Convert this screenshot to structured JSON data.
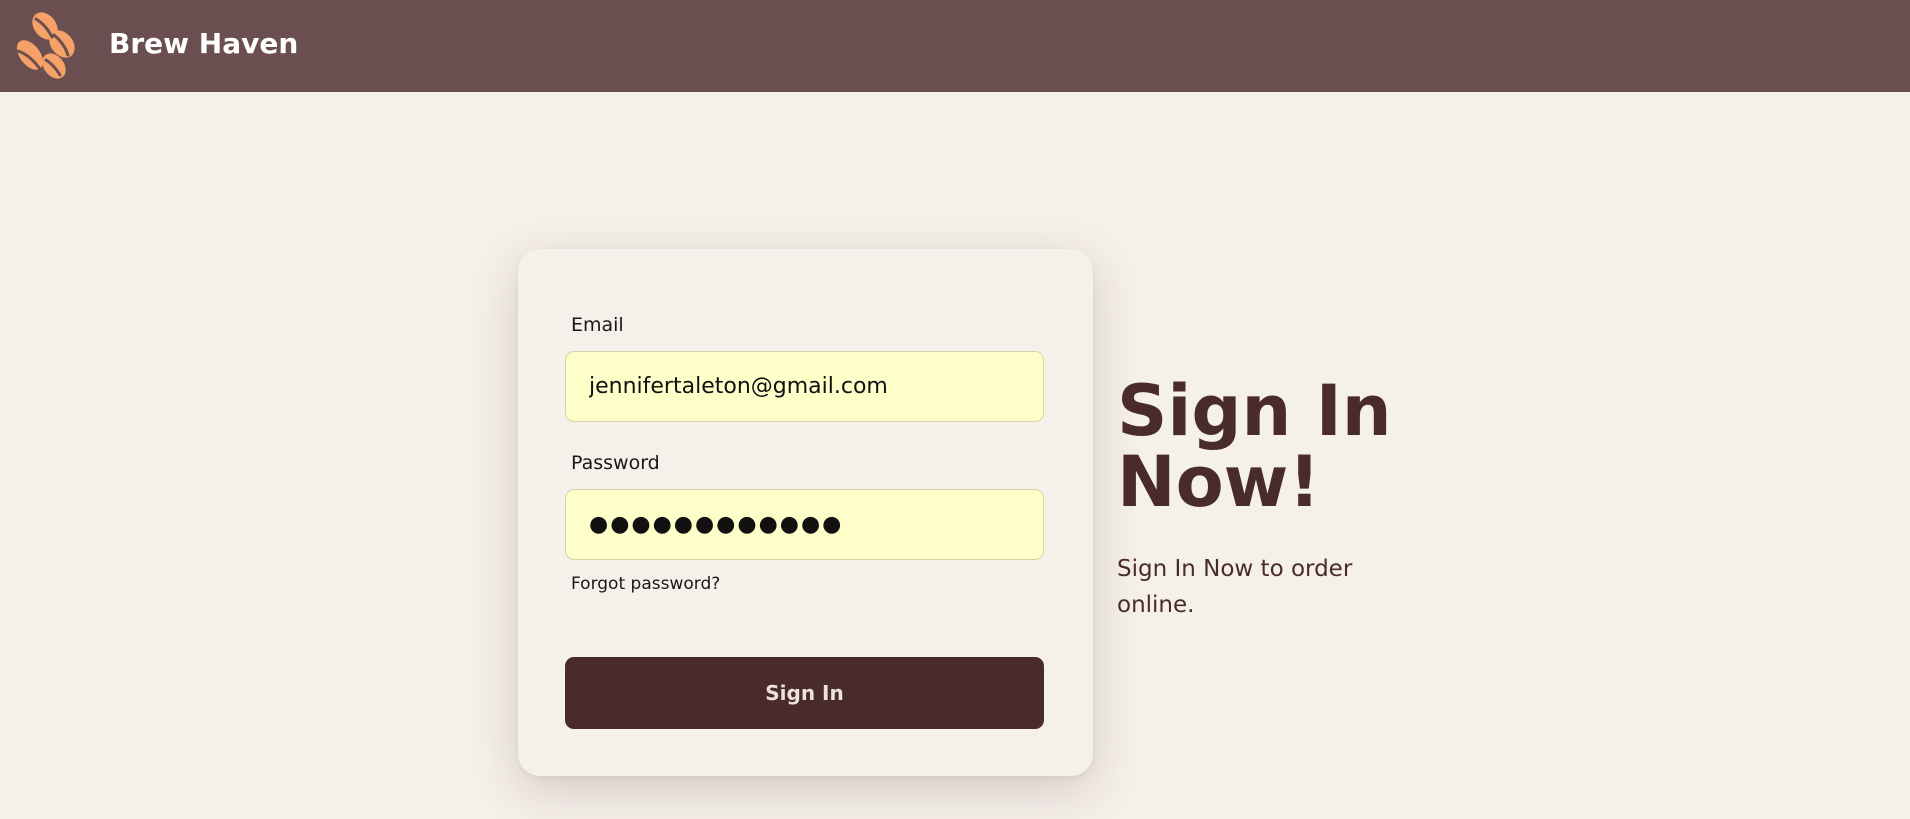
{
  "header": {
    "brand": "Brew Haven",
    "logo_icon": "coffee-beans-icon",
    "background": "#6b4f50",
    "logo_color": "#f5a167"
  },
  "signin_form": {
    "email_label": "Email",
    "email_value": "jennifertaleton@gmail.com",
    "password_label": "Password",
    "password_value": "●●●●●●●●●●●●",
    "forgot_password_label": "Forgot password?",
    "submit_label": "Sign In",
    "input_background": "#fefec8",
    "button_color": "#4a2b2b"
  },
  "hero": {
    "title": "Sign In Now!",
    "subtitle": "Sign In Now to order online.",
    "text_color": "#4a2b2b"
  },
  "page": {
    "background": "#f6f0ea"
  }
}
